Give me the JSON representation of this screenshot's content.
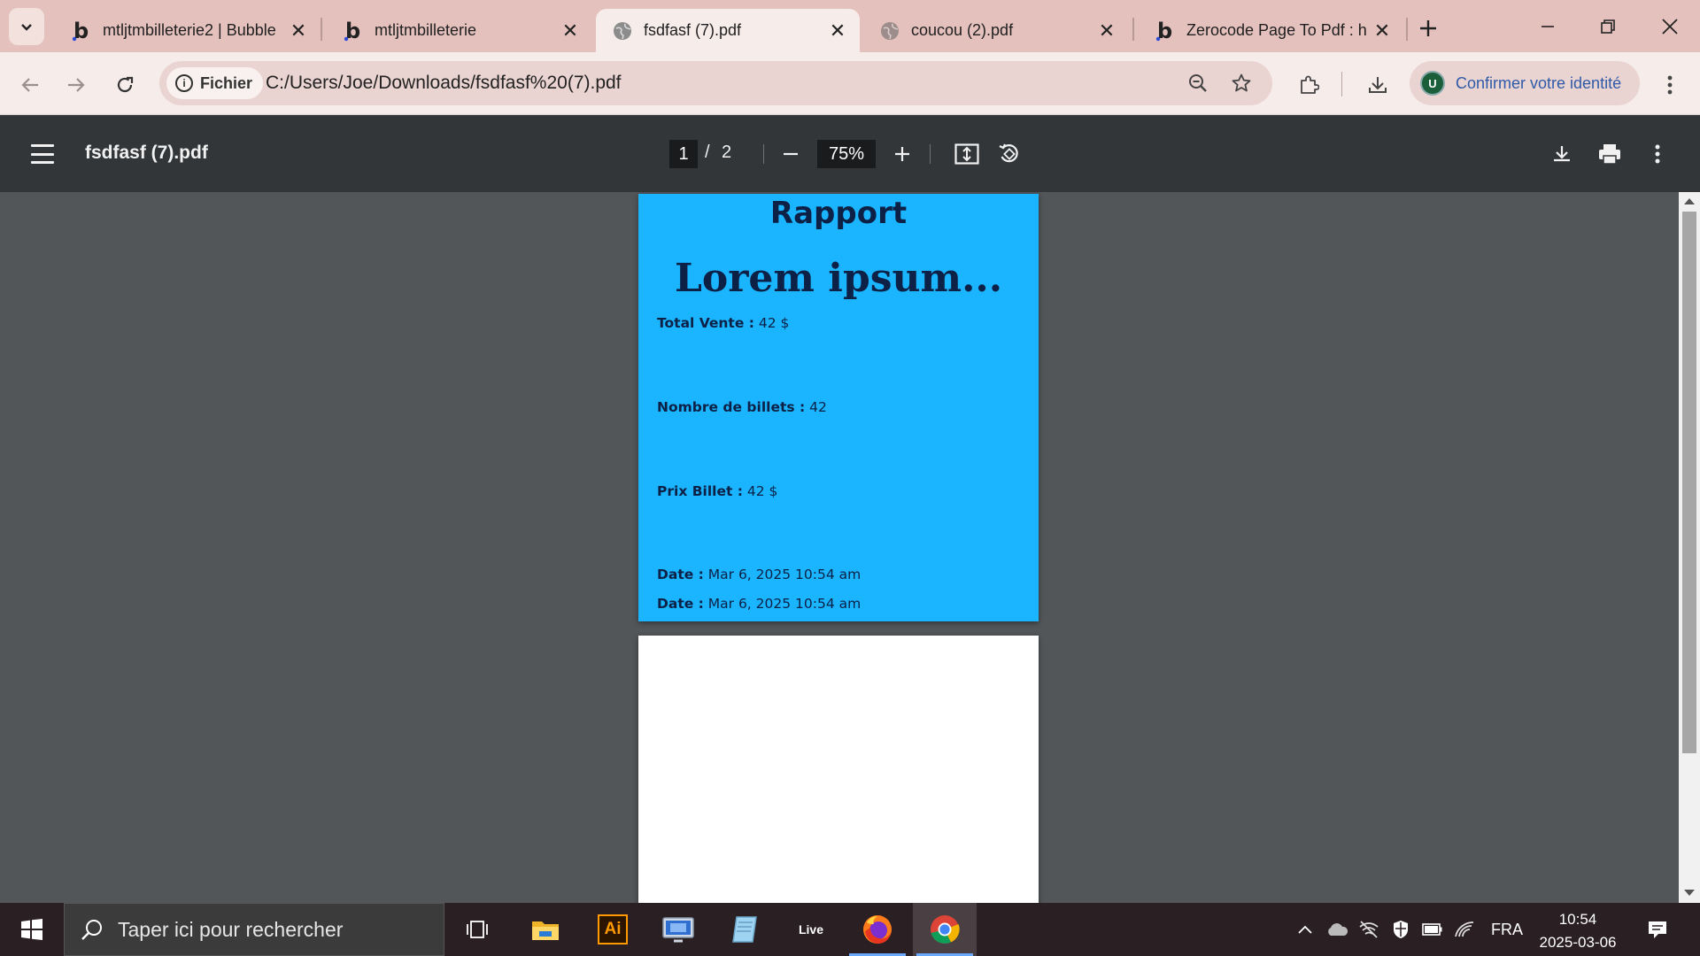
{
  "browser": {
    "tabs": [
      {
        "title": "mtljtmbilleteriе2 | Bubble",
        "favicon": "bubble-b-icon",
        "active": false
      },
      {
        "title": "mtljtmbilleterie",
        "favicon": "bubble-b-icon",
        "active": false
      },
      {
        "title": "fsdfasf (7).pdf",
        "favicon": "globe-icon",
        "active": true
      },
      {
        "title": "coucou (2).pdf",
        "favicon": "globe-icon",
        "active": false
      },
      {
        "title": "Zerocode Page To Pdf : h",
        "favicon": "bubble-b-icon",
        "active": false
      }
    ],
    "address": {
      "chip_label": "Fichier",
      "url": "C:/Users/Joe/Downloads/fsdfasf%20(7).pdf"
    },
    "profile": {
      "avatar_letter": "U",
      "label": "Confirmer votre identité"
    }
  },
  "pdf_toolbar": {
    "file_name": "fsdfasf (7).pdf",
    "current_page": "1",
    "page_separator": "/",
    "total_pages": "2",
    "zoom": "75%"
  },
  "document": {
    "heading": "Rapport",
    "title": "Lorem ipsum...",
    "fields": [
      {
        "label": "Total Vente :",
        "value": " 42 $"
      },
      {
        "label": "Nombre de billets :",
        "value": " 42"
      },
      {
        "label": "Prix Billet :",
        "value": " 42 $"
      },
      {
        "label": "Date :",
        "value": " Mar 6, 2025 10:54 am"
      },
      {
        "label": "Date :",
        "value": " Mar 6, 2025 10:54 am"
      }
    ],
    "page1_background": "#1ab4ff",
    "text_color": "#0d2146"
  },
  "taskbar": {
    "search_placeholder": "Taper ici pour rechercher",
    "apps": [
      "task-view-icon",
      "file-explorer-icon",
      "illustrator-icon",
      "remote-desktop-icon",
      "notepad-icon",
      "live-icon",
      "firefox-icon",
      "chrome-icon"
    ],
    "illustrator_label": "Ai",
    "live_label": "Live",
    "language": "FRA",
    "time": "10:54",
    "date": "2025-03-06"
  }
}
